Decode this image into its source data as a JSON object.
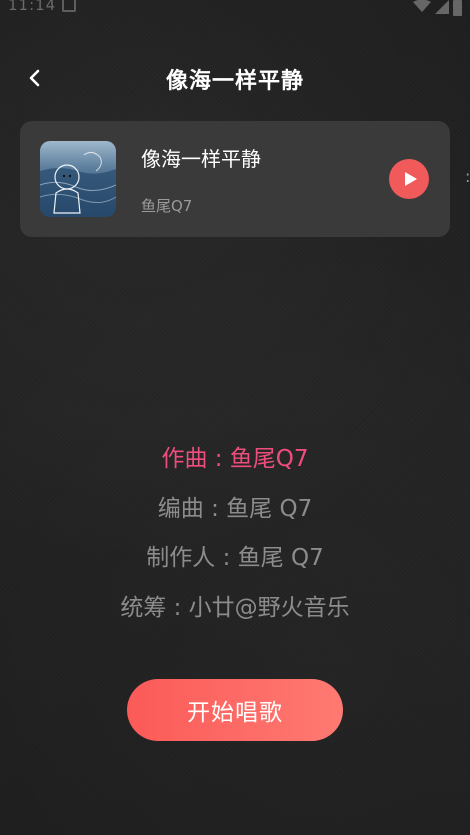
{
  "status_bar": {
    "time": "11:14",
    "icons": [
      "notification-icon",
      "wifi-icon",
      "signal-icon",
      "battery-icon"
    ]
  },
  "header": {
    "back_icon": "chevron-left-icon",
    "title": "像海一样平静"
  },
  "song_card": {
    "title": "像海一样平静",
    "artist": "鱼尾Q7",
    "cover_icon": "album-cover-image",
    "play_icon": "play-icon"
  },
  "credits": [
    {
      "text": "作曲 : 鱼尾Q7",
      "highlighted": true
    },
    {
      "text": "编曲 : 鱼尾 Q7",
      "highlighted": false
    },
    {
      "text": "制作人 : 鱼尾 Q7",
      "highlighted": false
    },
    {
      "text": "统筹 : 小廿@野火音乐",
      "highlighted": false
    }
  ],
  "start_button": {
    "label": "开始唱歌"
  },
  "colors": {
    "background": "#1e1e1e",
    "card": "#3a3a3b",
    "accent": "#f05a5a",
    "highlight_text": "#ee4d7d",
    "muted_text": "#8c8c8c"
  }
}
